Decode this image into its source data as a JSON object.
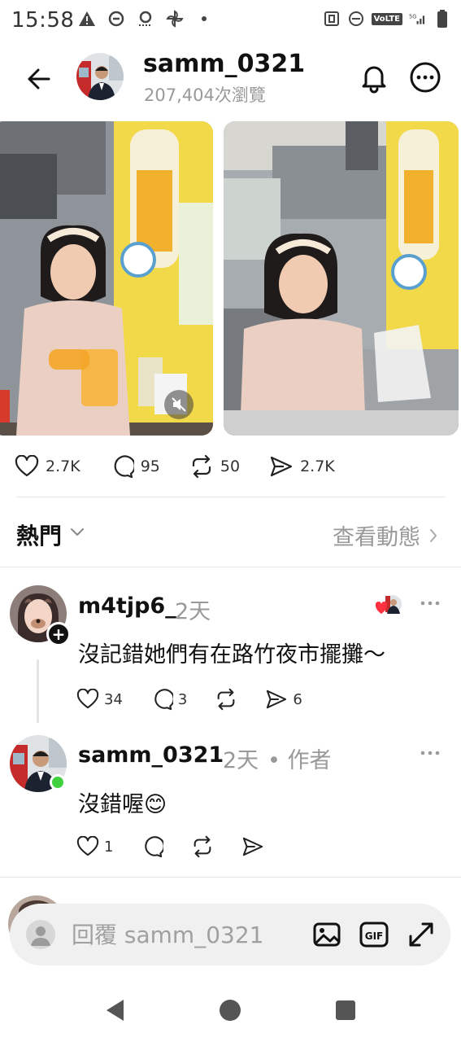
{
  "status_bar": {
    "time": "15:58",
    "left_icons": [
      "warning-icon",
      "data-saver-icon",
      "voicemail-icon",
      "pinwheel-icon",
      "dot-icon"
    ],
    "right_icons": [
      "nfc-icon",
      "dnd-icon",
      "volte-badge",
      "signal-5g-icon",
      "battery-icon"
    ],
    "volte": "VoLTE"
  },
  "header": {
    "username": "samm_0321",
    "views": "207,404次瀏覽"
  },
  "post": {
    "media": [
      {
        "kind": "video",
        "muted": true
      },
      {
        "kind": "image"
      }
    ],
    "actions": {
      "likes": "2.7K",
      "comments": "95",
      "reposts": "50",
      "shares": "2.7K"
    }
  },
  "sort_bar": {
    "label": "熱門",
    "activity_link": "查看動態"
  },
  "comments": [
    {
      "username": "m4tjp6_",
      "time": "2天",
      "author_tag": "",
      "text": "沒記錯她們有在路竹夜市擺攤～",
      "likes": "34",
      "replies": "3",
      "reposts": "",
      "shares": "6"
    },
    {
      "username": "samm_0321",
      "time": "2天",
      "author_tag": "• 作者",
      "text": "沒錯喔😊",
      "likes": "1",
      "replies": "",
      "reposts": "",
      "shares": ""
    }
  ],
  "reply_bar": {
    "placeholder": "回覆 samm_0321"
  },
  "colors": {
    "text": "#111111",
    "muted": "#999999",
    "divider": "#e6e6e6",
    "online": "#3fd13f",
    "heart_red": "#ff3040"
  }
}
